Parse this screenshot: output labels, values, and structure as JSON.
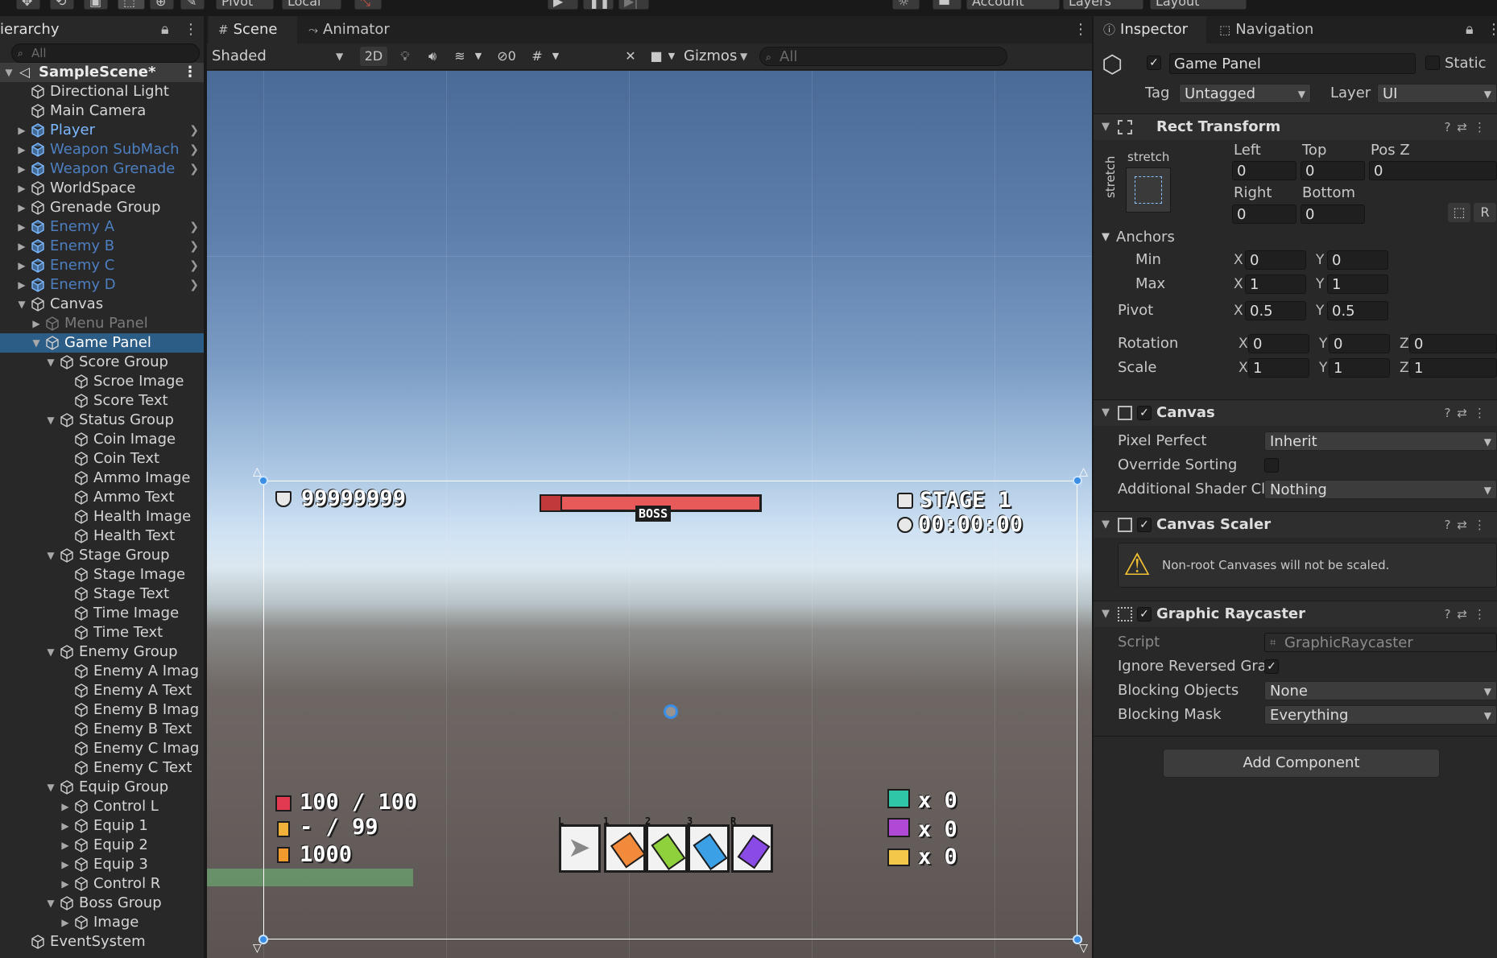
{
  "toolbar": {
    "pivot_label": "Pivot",
    "local_label": "Local",
    "account_label": "Account",
    "layers_label": "Layers",
    "layout_label": "Layout"
  },
  "hierarchy": {
    "tab_label": "ierarchy",
    "search_placeholder": "All",
    "scene_name": "SampleScene*",
    "items": [
      {
        "label": "Directional Light",
        "depth": 1,
        "arrow": "",
        "prefab": false,
        "chev": false,
        "style": "normal"
      },
      {
        "label": "Main Camera",
        "depth": 1,
        "arrow": "",
        "prefab": false,
        "chev": false,
        "style": "normal"
      },
      {
        "label": "Player",
        "depth": 1,
        "arrow": "right",
        "prefab": true,
        "chev": true,
        "style": "prefab"
      },
      {
        "label": "Weapon SubMach",
        "depth": 1,
        "arrow": "right",
        "prefab": true,
        "chev": true,
        "style": "prefab-dim"
      },
      {
        "label": "Weapon Grenade",
        "depth": 1,
        "arrow": "right",
        "prefab": true,
        "chev": true,
        "style": "prefab-dim"
      },
      {
        "label": "WorldSpace",
        "depth": 1,
        "arrow": "right",
        "prefab": false,
        "chev": false,
        "style": "normal"
      },
      {
        "label": "Grenade Group",
        "depth": 1,
        "arrow": "right",
        "prefab": false,
        "chev": false,
        "style": "normal"
      },
      {
        "label": "Enemy A",
        "depth": 1,
        "arrow": "right",
        "prefab": true,
        "chev": true,
        "style": "prefab-dim"
      },
      {
        "label": "Enemy B",
        "depth": 1,
        "arrow": "right",
        "prefab": true,
        "chev": true,
        "style": "prefab-dim"
      },
      {
        "label": "Enemy C",
        "depth": 1,
        "arrow": "right",
        "prefab": true,
        "chev": true,
        "style": "prefab-dim"
      },
      {
        "label": "Enemy D",
        "depth": 1,
        "arrow": "right",
        "prefab": true,
        "chev": true,
        "style": "prefab-dim"
      },
      {
        "label": "Canvas",
        "depth": 1,
        "arrow": "down",
        "prefab": false,
        "chev": false,
        "style": "normal"
      },
      {
        "label": "Menu Panel",
        "depth": 2,
        "arrow": "right",
        "prefab": false,
        "chev": false,
        "style": "disabled"
      },
      {
        "label": "Game Panel",
        "depth": 2,
        "arrow": "down",
        "prefab": false,
        "chev": false,
        "style": "selected"
      },
      {
        "label": "Score Group",
        "depth": 3,
        "arrow": "down",
        "prefab": false,
        "chev": false,
        "style": "normal"
      },
      {
        "label": "Scroe Image",
        "depth": 4,
        "arrow": "",
        "prefab": false,
        "chev": false,
        "style": "normal"
      },
      {
        "label": "Score Text",
        "depth": 4,
        "arrow": "",
        "prefab": false,
        "chev": false,
        "style": "normal"
      },
      {
        "label": "Status Group",
        "depth": 3,
        "arrow": "down",
        "prefab": false,
        "chev": false,
        "style": "normal"
      },
      {
        "label": "Coin Image",
        "depth": 4,
        "arrow": "",
        "prefab": false,
        "chev": false,
        "style": "normal"
      },
      {
        "label": "Coin Text",
        "depth": 4,
        "arrow": "",
        "prefab": false,
        "chev": false,
        "style": "normal"
      },
      {
        "label": "Ammo Image",
        "depth": 4,
        "arrow": "",
        "prefab": false,
        "chev": false,
        "style": "normal"
      },
      {
        "label": "Ammo Text",
        "depth": 4,
        "arrow": "",
        "prefab": false,
        "chev": false,
        "style": "normal"
      },
      {
        "label": "Health Image",
        "depth": 4,
        "arrow": "",
        "prefab": false,
        "chev": false,
        "style": "normal"
      },
      {
        "label": "Health Text",
        "depth": 4,
        "arrow": "",
        "prefab": false,
        "chev": false,
        "style": "normal"
      },
      {
        "label": "Stage Group",
        "depth": 3,
        "arrow": "down",
        "prefab": false,
        "chev": false,
        "style": "normal"
      },
      {
        "label": "Stage Image",
        "depth": 4,
        "arrow": "",
        "prefab": false,
        "chev": false,
        "style": "normal"
      },
      {
        "label": "Stage Text",
        "depth": 4,
        "arrow": "",
        "prefab": false,
        "chev": false,
        "style": "normal"
      },
      {
        "label": "Time Image",
        "depth": 4,
        "arrow": "",
        "prefab": false,
        "chev": false,
        "style": "normal"
      },
      {
        "label": "Time Text",
        "depth": 4,
        "arrow": "",
        "prefab": false,
        "chev": false,
        "style": "normal"
      },
      {
        "label": "Enemy Group",
        "depth": 3,
        "arrow": "down",
        "prefab": false,
        "chev": false,
        "style": "normal"
      },
      {
        "label": "Enemy A Imag",
        "depth": 4,
        "arrow": "",
        "prefab": false,
        "chev": false,
        "style": "normal"
      },
      {
        "label": "Enemy A Text",
        "depth": 4,
        "arrow": "",
        "prefab": false,
        "chev": false,
        "style": "normal"
      },
      {
        "label": "Enemy B Imag",
        "depth": 4,
        "arrow": "",
        "prefab": false,
        "chev": false,
        "style": "normal"
      },
      {
        "label": "Enemy B Text",
        "depth": 4,
        "arrow": "",
        "prefab": false,
        "chev": false,
        "style": "normal"
      },
      {
        "label": "Enemy C Imag",
        "depth": 4,
        "arrow": "",
        "prefab": false,
        "chev": false,
        "style": "normal"
      },
      {
        "label": "Enemy C Text",
        "depth": 4,
        "arrow": "",
        "prefab": false,
        "chev": false,
        "style": "normal"
      },
      {
        "label": "Equip Group",
        "depth": 3,
        "arrow": "down",
        "prefab": false,
        "chev": false,
        "style": "normal"
      },
      {
        "label": "Control L",
        "depth": 4,
        "arrow": "right",
        "prefab": false,
        "chev": false,
        "style": "normal"
      },
      {
        "label": "Equip 1",
        "depth": 4,
        "arrow": "right",
        "prefab": false,
        "chev": false,
        "style": "normal"
      },
      {
        "label": "Equip 2",
        "depth": 4,
        "arrow": "right",
        "prefab": false,
        "chev": false,
        "style": "normal"
      },
      {
        "label": "Equip 3",
        "depth": 4,
        "arrow": "right",
        "prefab": false,
        "chev": false,
        "style": "normal"
      },
      {
        "label": "Control R",
        "depth": 4,
        "arrow": "right",
        "prefab": false,
        "chev": false,
        "style": "normal"
      },
      {
        "label": "Boss Group",
        "depth": 3,
        "arrow": "down",
        "prefab": false,
        "chev": false,
        "style": "normal"
      },
      {
        "label": "Image",
        "depth": 4,
        "arrow": "right",
        "prefab": false,
        "chev": false,
        "style": "normal"
      },
      {
        "label": "EventSystem",
        "depth": 1,
        "arrow": "",
        "prefab": false,
        "chev": false,
        "style": "normal"
      }
    ]
  },
  "scene": {
    "tab_scene": "Scene",
    "tab_animator": "Animator",
    "shading_mode": "Shaded",
    "mode_2d": "2D",
    "hidden_count": "0",
    "gizmos_label": "Gizmos",
    "search_placeholder": "All"
  },
  "hud": {
    "score": "99999999",
    "boss_label": "BOSS",
    "stage": "STAGE 1",
    "time": "00:00:00",
    "health": "100 / 100",
    "ammo": "- / 99",
    "coin": "1000",
    "enemy_a_count": "x 0",
    "enemy_b_count": "x 0",
    "enemy_c_count": "x 0",
    "equip_keys": [
      "L",
      "1",
      "2",
      "3",
      "R"
    ],
    "colors": {
      "boss_bar": "#e85a5a",
      "enemy_a": "#2fc6a8",
      "enemy_b": "#b04ad6",
      "enemy_c": "#f2c84b",
      "health_icon": "#e23a50",
      "ammo_icon": "#f2b23a",
      "coin_icon": "#f29a2e"
    }
  },
  "inspector": {
    "tab_inspector": "Inspector",
    "tab_navigation": "Navigation",
    "object_name": "Game Panel",
    "static_label": "Static",
    "tag_label": "Tag",
    "tag_value": "Untagged",
    "layer_label": "Layer",
    "layer_value": "UI",
    "rect_transform": {
      "title": "Rect Transform",
      "stretch_h": "stretch",
      "stretch_v": "stretch",
      "left_label": "Left",
      "left": "0",
      "top_label": "Top",
      "top": "0",
      "posz_label": "Pos Z",
      "posz": "0",
      "right_label": "Right",
      "right": "0",
      "bottom_label": "Bottom",
      "bottom": "0",
      "r_button": "R",
      "anchors_label": "Anchors",
      "min_label": "Min",
      "min_x": "0",
      "min_y": "0",
      "max_label": "Max",
      "max_x": "1",
      "max_y": "1",
      "pivot_label": "Pivot",
      "pivot_x": "0.5",
      "pivot_y": "0.5",
      "rotation_label": "Rotation",
      "rot_x": "0",
      "rot_y": "0",
      "rot_z": "0",
      "scale_label": "Scale",
      "scale_x": "1",
      "scale_y": "1",
      "scale_z": "1"
    },
    "canvas": {
      "title": "Canvas",
      "pixel_perfect_label": "Pixel Perfect",
      "pixel_perfect": "Inherit",
      "override_sorting_label": "Override Sorting",
      "shader_label": "Additional Shader Cl",
      "shader_value": "Nothing"
    },
    "canvas_scaler": {
      "title": "Canvas Scaler",
      "warning": "Non-root Canvases will not be scaled."
    },
    "raycaster": {
      "title": "Graphic Raycaster",
      "script_label": "Script",
      "script_value": "GraphicRaycaster",
      "ignore_label": "Ignore Reversed Gra",
      "blocking_objects_label": "Blocking Objects",
      "blocking_objects": "None",
      "blocking_mask_label": "Blocking Mask",
      "blocking_mask": "Everything"
    },
    "add_component": "Add Component"
  }
}
